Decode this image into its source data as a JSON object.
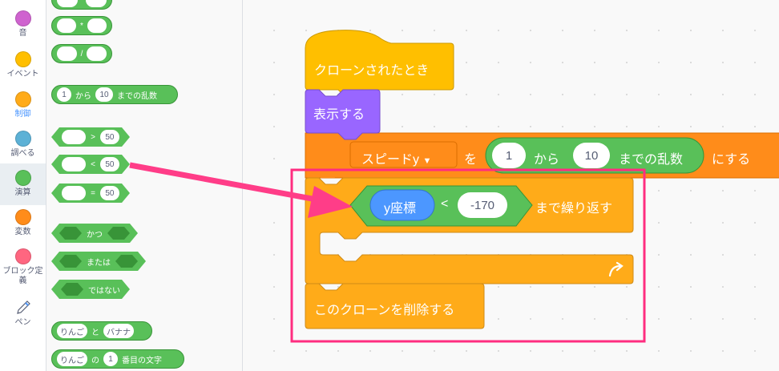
{
  "categories": [
    {
      "label": "音",
      "color": "#cf63cf"
    },
    {
      "label": "イベント",
      "color": "#ffbf00"
    },
    {
      "label": "制御",
      "color": "#ffab19"
    },
    {
      "label": "調べる",
      "color": "#5cb1d6"
    },
    {
      "label": "演算",
      "color": "#59c059",
      "active": true
    },
    {
      "label": "変数",
      "color": "#ff8c1a"
    },
    {
      "label": "ブロック定義",
      "color": "#ff6680"
    },
    {
      "label": "ペン",
      "icon": "pen-icon"
    }
  ],
  "palette": {
    "mul_op": "*",
    "div_op": "/",
    "random": {
      "from": "1",
      "t1": "から",
      "to": "10",
      "t2": "までの乱数"
    },
    "gt": {
      "op": ">",
      "val": "50"
    },
    "lt": {
      "op": "<",
      "val": "50"
    },
    "eq": {
      "op": "=",
      "val": "50"
    },
    "and": "かつ",
    "or": "または",
    "not": "ではない",
    "join": {
      "a": "りんご",
      "t": "と",
      "b": "バナナ"
    },
    "letter": {
      "a": "りんご",
      "t1": "の",
      "n": "1",
      "t2": "番目の文字"
    }
  },
  "script": {
    "hat": "クローンされたとき",
    "show": "表示する",
    "setvar": {
      "var": "スピードy",
      "wo": "を",
      "from": "1",
      "kara": "から",
      "to": "10",
      "rand": "までの乱数",
      "suru": "にする"
    },
    "repeat": {
      "reporter": "y座標",
      "op": "<",
      "val": "-170",
      "label": "まで繰り返す"
    },
    "delete": "このクローンを削除する"
  },
  "colors": {
    "control": "#ffab19",
    "events": "#ffbf00",
    "looks": "#9966ff",
    "operators": "#59c059",
    "variables": "#ff8c1a",
    "motion": "#4c97ff",
    "highlight": "#ff2d80"
  }
}
